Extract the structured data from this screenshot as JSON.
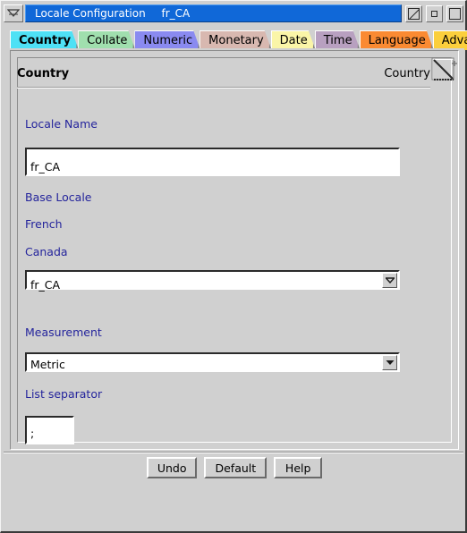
{
  "window": {
    "title": "Locale Configuration",
    "title_suffix": "fr_CA",
    "menu_icon": "window-menu-icon",
    "buttons": [
      {
        "name": "restore-button",
        "icon": "diagonal-box-icon"
      },
      {
        "name": "minimize-button",
        "icon": "small-square-icon"
      },
      {
        "name": "maximize-button",
        "icon": "large-square-icon"
      }
    ]
  },
  "tabs": [
    {
      "label": "Country",
      "color": "#4ee1f5",
      "active": true
    },
    {
      "label": "Collate",
      "color": "#a0dfae",
      "active": false
    },
    {
      "label": "Numeric",
      "color": "#8a8af0",
      "active": false
    },
    {
      "label": "Monetary",
      "color": "#d8b8b0",
      "active": false
    },
    {
      "label": "Date",
      "color": "#faf5a8",
      "active": false
    },
    {
      "label": "Time",
      "color": "#b8a0c0",
      "active": false
    },
    {
      "label": "Language",
      "color": "#fa8a32",
      "active": false
    },
    {
      "label": "Advanced",
      "color": "#fbcf3c",
      "active": false
    }
  ],
  "panel": {
    "heading": "Country",
    "heading_right": "Country",
    "corner_icon": "page-fold-tearoff-icon"
  },
  "form": {
    "locale_name_label": "Locale Name",
    "locale_name_value": "fr_CA",
    "base_locale_label": "Base Locale",
    "language_value": "French",
    "country_value": "Canada",
    "base_locale_combo_value": "fr_CA",
    "measurement_label": "Measurement",
    "measurement_value": "Metric",
    "list_separator_label": "List separator",
    "list_separator_value": ";"
  },
  "buttons": {
    "undo": "Undo",
    "default": "Default",
    "help": "Help"
  },
  "colors": {
    "face": "#d0d0d0",
    "label_blue": "#24249c",
    "titlebar_blue": "#1068d8"
  }
}
